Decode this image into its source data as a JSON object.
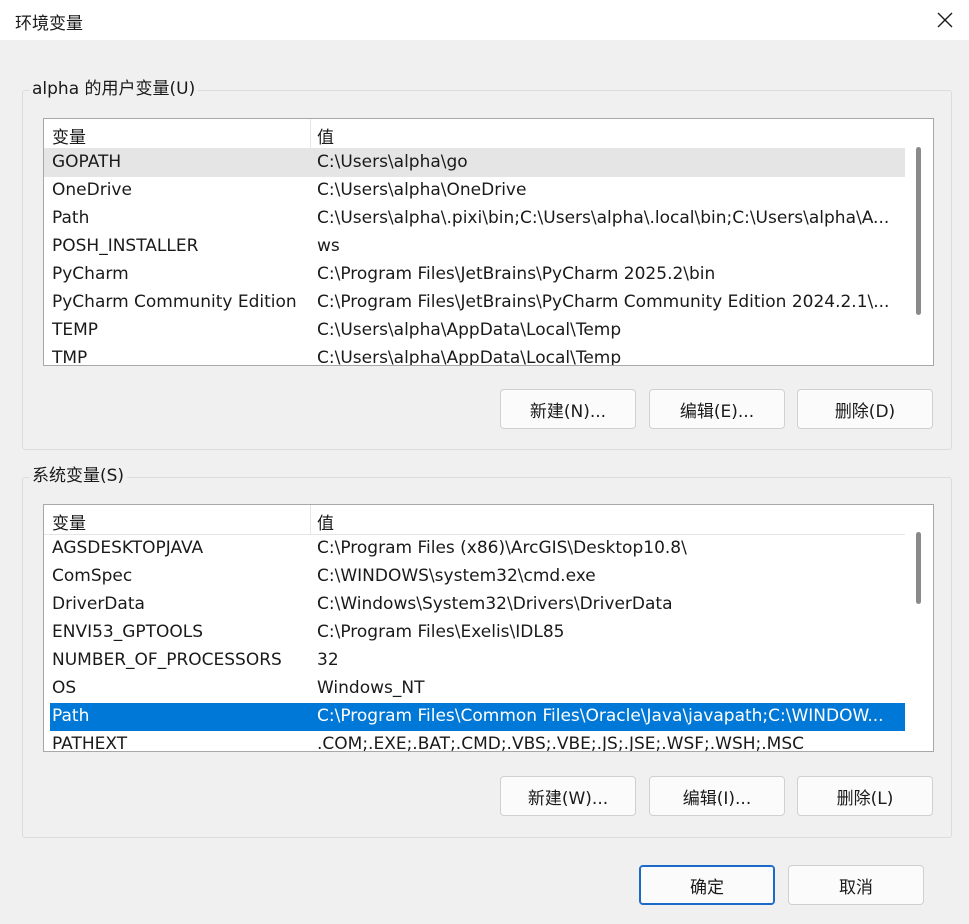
{
  "window": {
    "title": "环境变量",
    "close_icon": "close-icon"
  },
  "user_vars": {
    "group_label": "alpha 的用户变量(U)",
    "header": {
      "name": "变量",
      "value": "值"
    },
    "rows": [
      {
        "name": "GOPATH",
        "value": "C:\\Users\\alpha\\go"
      },
      {
        "name": "OneDrive",
        "value": "C:\\Users\\alpha\\OneDrive"
      },
      {
        "name": "Path",
        "value": "C:\\Users\\alpha\\.pixi\\bin;C:\\Users\\alpha\\.local\\bin;C:\\Users\\alpha\\A..."
      },
      {
        "name": "POSH_INSTALLER",
        "value": "ws"
      },
      {
        "name": "PyCharm",
        "value": "C:\\Program Files\\JetBrains\\PyCharm 2025.2\\bin"
      },
      {
        "name": "PyCharm Community Edition",
        "value": "C:\\Program Files\\JetBrains\\PyCharm Community Edition 2024.2.1\\..."
      },
      {
        "name": "TEMP",
        "value": "C:\\Users\\alpha\\AppData\\Local\\Temp"
      },
      {
        "name": "TMP",
        "value": "C:\\Users\\alpha\\AppData\\Local\\Temp"
      }
    ],
    "buttons": {
      "new_label": "新建(N)...",
      "edit_label": "编辑(E)...",
      "delete_label": "删除(D)"
    }
  },
  "system_vars": {
    "group_label": "系统变量(S)",
    "header": {
      "name": "变量",
      "value": "值"
    },
    "rows": [
      {
        "name": "AGSDESKTOPJAVA",
        "value": "C:\\Program Files (x86)\\ArcGIS\\Desktop10.8\\"
      },
      {
        "name": "ComSpec",
        "value": "C:\\WINDOWS\\system32\\cmd.exe"
      },
      {
        "name": "DriverData",
        "value": "C:\\Windows\\System32\\Drivers\\DriverData"
      },
      {
        "name": "ENVI53_GPTOOLS",
        "value": "C:\\Program Files\\Exelis\\IDL85"
      },
      {
        "name": "NUMBER_OF_PROCESSORS",
        "value": "32"
      },
      {
        "name": "OS",
        "value": "Windows_NT"
      },
      {
        "name": "Path",
        "value": "C:\\Program Files\\Common Files\\Oracle\\Java\\javapath;C:\\WINDOW..."
      },
      {
        "name": "PATHEXT",
        "value": ".COM;.EXE;.BAT;.CMD;.VBS;.VBE;.JS;.JSE;.WSF;.WSH;.MSC"
      }
    ],
    "buttons": {
      "new_label": "新建(W)...",
      "edit_label": "编辑(I)...",
      "delete_label": "删除(L)"
    }
  },
  "footer": {
    "ok_label": "确定",
    "cancel_label": "取消"
  },
  "colors": {
    "selection": "#0078d7",
    "hover": "#e5e5e5",
    "background": "#f0f0f0"
  }
}
